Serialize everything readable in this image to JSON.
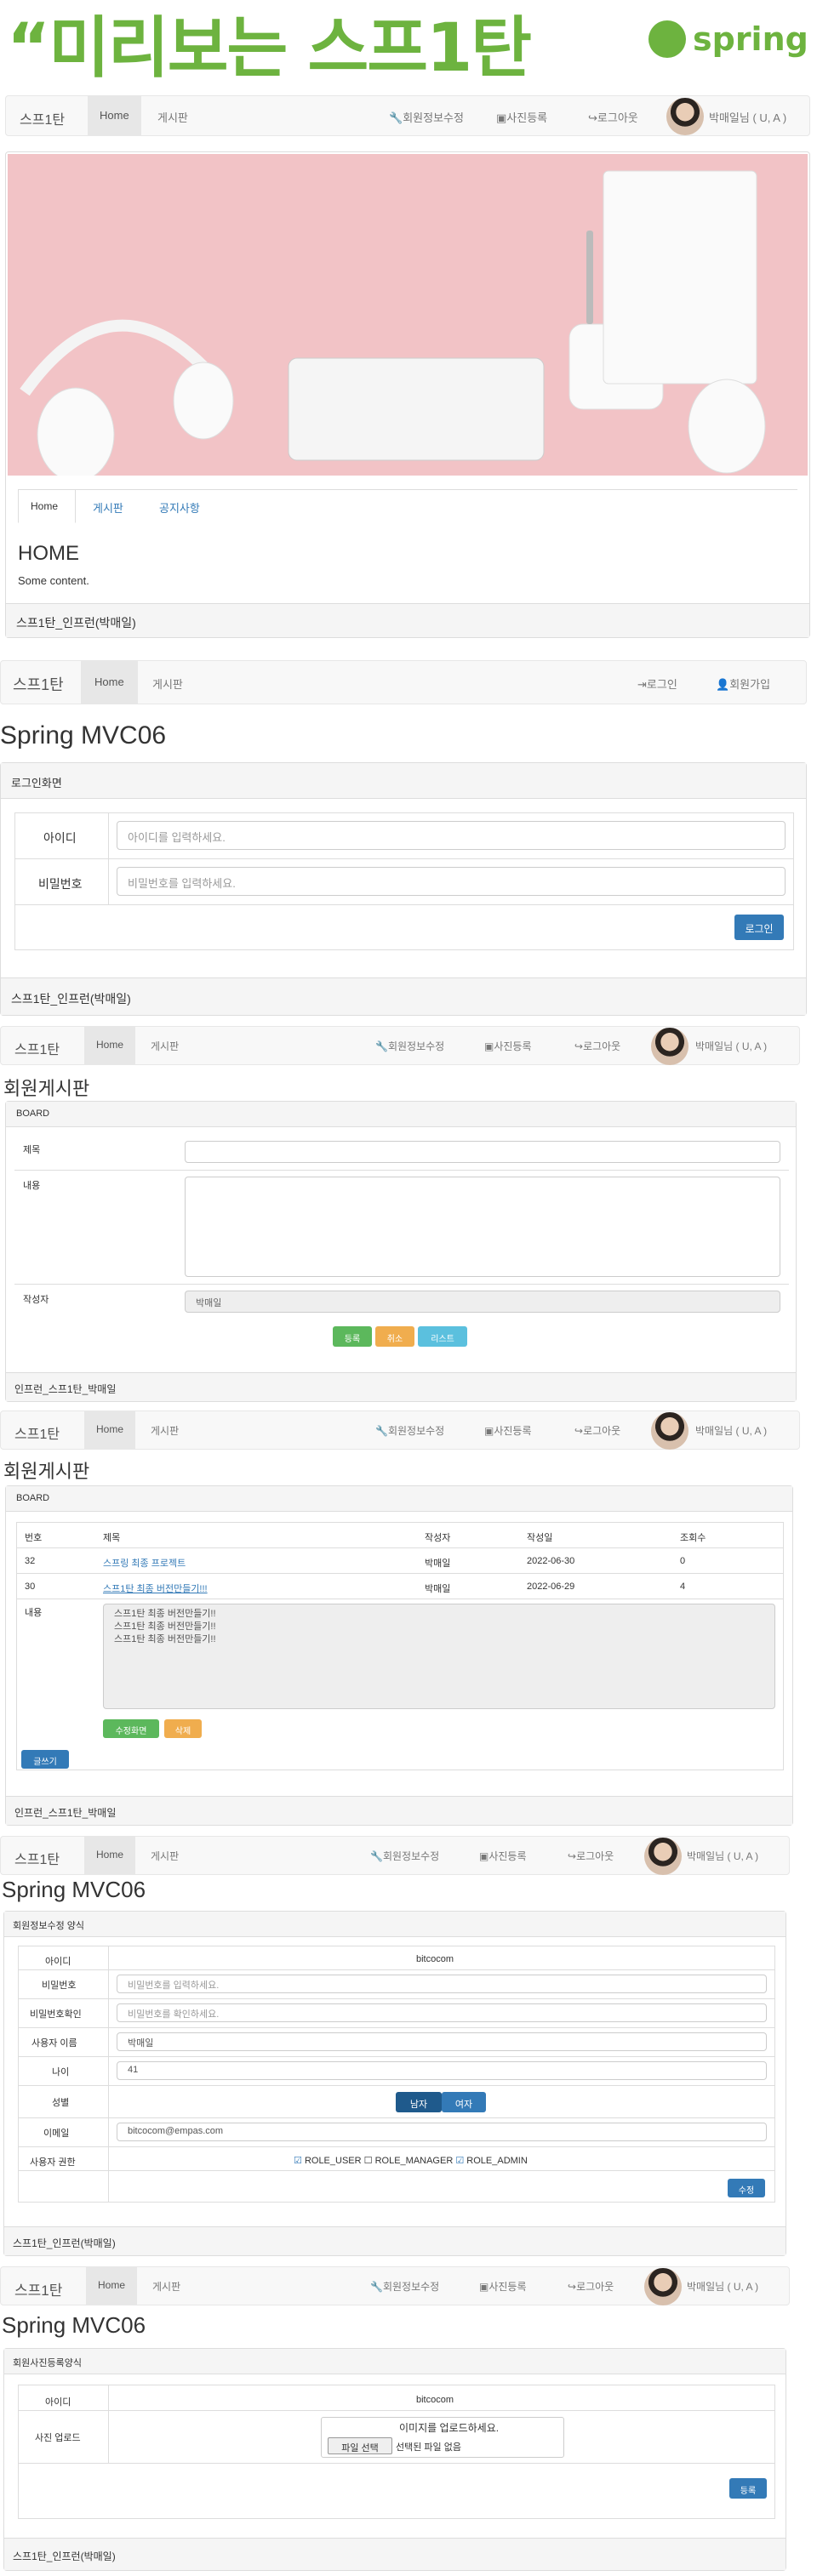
{
  "hero": {
    "title": "“미리보는 스프1탄",
    "logo": "spring"
  },
  "nav": {
    "brand": "스프1탄",
    "home": "Home",
    "board": "게시판",
    "modify": "회원정보수정",
    "photo": "사진등록",
    "logout": "로그아웃",
    "user": "박매일님 ( U, A )",
    "login": "로그인",
    "join": "회원가입"
  },
  "s1": {
    "tabs": [
      "Home",
      "게시판",
      "공지사항"
    ],
    "heading": "HOME",
    "content": "Some content.",
    "footer": "스프1탄_인프런(박매일)"
  },
  "s2": {
    "title": "Spring MVC06",
    "panel": "로그인화면",
    "id_label": "아이디",
    "id_ph": "아이디를 입력하세요.",
    "pw_label": "비밀번호",
    "pw_ph": "비밀번호를 입력하세요.",
    "btn": "로그인",
    "footer": "스프1탄_인프런(박매일)"
  },
  "s3": {
    "title": "회원게시판",
    "panel": "BOARD",
    "t_label": "제목",
    "c_label": "내용",
    "w_label": "작성자",
    "writer": "박매일",
    "b1": "등록",
    "b2": "취소",
    "b3": "리스트",
    "footer": "인프런_스프1탄_박매일"
  },
  "s4": {
    "title": "회원게시판",
    "panel": "BOARD",
    "cols": [
      "번호",
      "제목",
      "작성자",
      "작성일",
      "조회수"
    ],
    "rows": [
      [
        "32",
        "스프링 최종 프로젝트",
        "박매일",
        "2022-06-30",
        "0"
      ],
      [
        "30",
        "스프1탄 최종 버전만들기!!!",
        "박매일",
        "2022-06-29",
        "4"
      ]
    ],
    "c_label": "내용",
    "content": [
      "스프1탄 최종 버전만들기!!",
      "스프1탄 최종 버전만들기!!",
      "스프1탄 최종 버전만들기!!"
    ],
    "b1": "수정화면",
    "b2": "삭제",
    "write": "글쓰기",
    "footer": "인프런_스프1탄_박매일"
  },
  "s5": {
    "title": "Spring MVC06",
    "panel": "회원정보수정 양식",
    "id_label": "아이디",
    "id": "bitcocom",
    "pw_label": "비밀번호",
    "pw_ph": "비밀번호를 입력하세요.",
    "pw2_label": "비밀번호확인",
    "pw2_ph": "비밀번호를 확인하세요.",
    "name_label": "사용자 이름",
    "name": "박매일",
    "age_label": "나이",
    "age": "41",
    "gender_label": "성별",
    "male": "남자",
    "female": "여자",
    "email_label": "이메일",
    "email": "bitcocom@empas.com",
    "role_label": "사용자 권한",
    "roles": [
      "ROLE_USER",
      "ROLE_MANAGER",
      "ROLE_ADMIN"
    ],
    "btn": "수정",
    "footer": "스프1탄_인프런(박매일)"
  },
  "s6": {
    "title": "Spring MVC06",
    "panel": "회원사진등록양식",
    "id_label": "아이디",
    "id": "bitcocom",
    "up_label": "사진 업로드",
    "up_msg": "이미지를 업로드하세요.",
    "file_btn": "파일 선택",
    "no_file": "선택된 파일 없음",
    "btn": "등록",
    "footer": "스프1탄_인프런(박매일)"
  }
}
